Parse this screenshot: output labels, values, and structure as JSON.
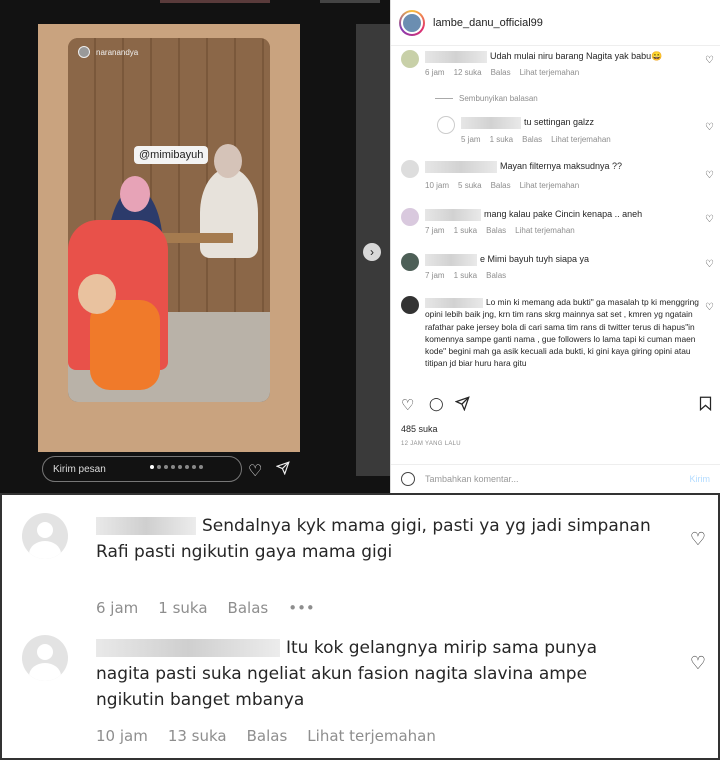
{
  "story": {
    "author": "naranandya",
    "mention": "@mimibayuh",
    "reply_placeholder": "Kirim pesan",
    "heart_icon": "heart-icon",
    "send_icon": "send-icon"
  },
  "post": {
    "username": "lambe_danu_official99",
    "comments": [
      {
        "text": "Udah mulai niru barang Nagita yak babu😀",
        "time": "6 jam",
        "likes": "12 suka",
        "reply": "Balas",
        "translate": "Lihat terjemahan"
      },
      {
        "text": "tu settingan galzz",
        "time": "5 jam",
        "likes": "1 suka",
        "reply": "Balas",
        "translate": "Lihat terjemahan"
      },
      {
        "text": "Mayan filternya maksudnya ??",
        "time": "10 jam",
        "likes": "5 suka",
        "reply": "Balas",
        "translate": "Lihat terjemahan"
      },
      {
        "text": "mang kalau pake Cincin kenapa .. aneh",
        "time": "7 jam",
        "likes": "1 suka",
        "reply": "Balas",
        "translate": "Lihat terjemahan"
      },
      {
        "text": "e Mimi bayuh tuyh siapa ya",
        "time": "7 jam",
        "likes": "1 suka",
        "reply": "Balas"
      },
      {
        "text": "Lo min ki memang ada bukti\" ga masalah tp ki menggring opini lebih baik jng, krn tim rans skrg mainnya sat set , kmren yg ngatain rafathar pake jersey bola di cari sama tim rans di twitter terus di hapus\"in komennya sampe ganti nama , gue followers lo lama tapi ki cuman maen kode\" begini mah ga asik kecuali ada bukti, ki gini kaya giring opini atau titipan jd biar huru hara gitu"
      }
    ],
    "hide_replies": "Sembunyikan balasan",
    "likes": "485 suka",
    "time_ago": "12 JAM YANG LALU",
    "add_comment_placeholder": "Tambahkan komentar...",
    "post_label": "Kirim"
  },
  "zoom": {
    "comments": [
      {
        "text_first": "Sendalnya kyk mama gigi, pasti ya yg jadi simpanan",
        "text_second": "Rafi pasti ngikutin gaya mama gigi",
        "time": "6 jam",
        "likes": "1 suka",
        "reply": "Balas",
        "more": "•••"
      },
      {
        "text_first": "Itu kok gelangnya mirip sama punya",
        "text_second": "nagita pasti suka ngeliat akun fasion nagita slavina ampe",
        "text_third": "ngikutin banget mbanya",
        "time": "10 jam",
        "likes": "13 suka",
        "reply": "Balas",
        "translate": "Lihat terjemahan"
      }
    ]
  }
}
